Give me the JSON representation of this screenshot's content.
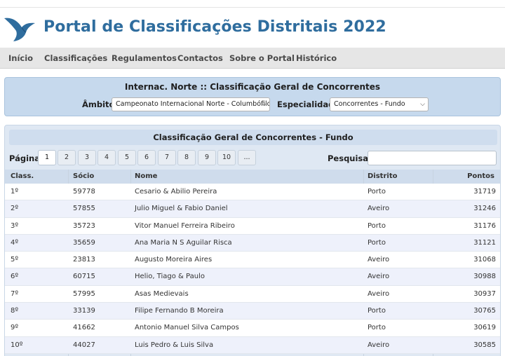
{
  "site": {
    "title": "Portal de Classificações Distritais 2022",
    "accent_color": "#2f6d9e",
    "logo_icon": "pigeon-logo-icon"
  },
  "nav": {
    "items": [
      "Início",
      "Classificações",
      "Regulamentos",
      "Contactos",
      "Sobre o Portal",
      "Histórico"
    ]
  },
  "filters": {
    "title": "Internac. Norte :: Classificação Geral de Concorrentes",
    "ambito_label": "Âmbito:",
    "ambito_value": "Campeonato Internacional Norte - Columbófilo",
    "especialidade_label": "Especialidade:",
    "especialidade_value": "Concorrentes - Fundo"
  },
  "results": {
    "title": "Classificação Geral de Concorrentes - Fundo",
    "pagination_label": "Página:",
    "pages": [
      "1",
      "2",
      "3",
      "4",
      "5",
      "6",
      "7",
      "8",
      "9",
      "10",
      "..."
    ],
    "current_page": "1",
    "search_label": "Pesquisar:",
    "search_value": "",
    "columns": [
      "Class.",
      "Sócio",
      "Nome",
      "Distrito",
      "Pontos"
    ],
    "rows": [
      {
        "class": "1º",
        "socio": "59778",
        "nome": "Cesario & Abilio Pereira",
        "distrito": "Porto",
        "pontos": "31719"
      },
      {
        "class": "2º",
        "socio": "57855",
        "nome": "Julio Miguel & Fabio Daniel",
        "distrito": "Aveiro",
        "pontos": "31246"
      },
      {
        "class": "3º",
        "socio": "35723",
        "nome": "Vitor Manuel Ferreira Ribeiro",
        "distrito": "Porto",
        "pontos": "31176"
      },
      {
        "class": "4º",
        "socio": "35659",
        "nome": "Ana Maria N S Aguilar Risca",
        "distrito": "Porto",
        "pontos": "31121"
      },
      {
        "class": "5º",
        "socio": "23813",
        "nome": "Augusto Moreira Aires",
        "distrito": "Aveiro",
        "pontos": "31068"
      },
      {
        "class": "6º",
        "socio": "60715",
        "nome": "Helio, Tiago & Paulo",
        "distrito": "Aveiro",
        "pontos": "30988"
      },
      {
        "class": "7º",
        "socio": "57995",
        "nome": "Asas Medievais",
        "distrito": "Aveiro",
        "pontos": "30937"
      },
      {
        "class": "8º",
        "socio": "33139",
        "nome": "Filipe Fernando B Moreira",
        "distrito": "Porto",
        "pontos": "30765"
      },
      {
        "class": "9º",
        "socio": "41662",
        "nome": "Antonio Manuel Silva Campos",
        "distrito": "Porto",
        "pontos": "30619"
      },
      {
        "class": "10º",
        "socio": "44027",
        "nome": "Luis Pedro & Luis Silva",
        "distrito": "Aveiro",
        "pontos": "30585"
      }
    ]
  }
}
